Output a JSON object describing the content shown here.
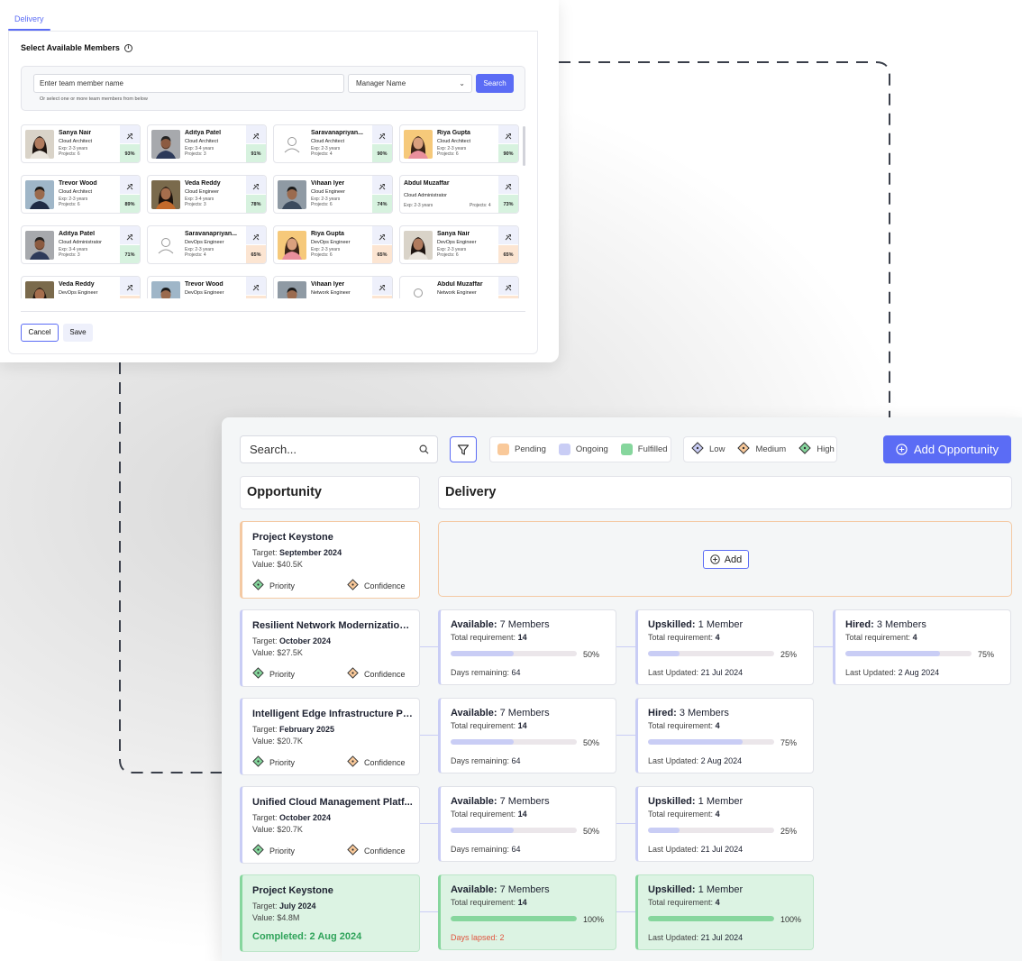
{
  "dialog": {
    "tab": "Delivery",
    "heading": "Select Available Members",
    "search": {
      "input_value": "Enter team member name",
      "manager_select": "Manager Name",
      "search_button": "Search",
      "hint": "Or select one or more team members from below"
    },
    "members": [
      {
        "name": "Sanya Nair",
        "role": "Cloud Architect",
        "exp": "Exp: 2-3 years",
        "projects": "Projects: 6",
        "pct": "93%",
        "tone": "g",
        "photo": "female-1"
      },
      {
        "name": "Aditya Patel",
        "role": "Cloud Architect",
        "exp": "Exp: 3-4 years",
        "projects": "Projects: 3",
        "pct": "91%",
        "tone": "g",
        "photo": "male-beard"
      },
      {
        "name": "Saravanapriyan...",
        "role": "Cloud Architect",
        "exp": "Exp: 2-3 years",
        "projects": "Projects: 4",
        "pct": "90%",
        "tone": "g",
        "photo": "placeholder"
      },
      {
        "name": "Riya Gupta",
        "role": "Cloud Architect",
        "exp": "Exp: 2-3 years",
        "projects": "Projects: 6",
        "pct": "90%",
        "tone": "g",
        "photo": "female-2"
      },
      {
        "name": "Trevor Wood",
        "role": "Cloud Architect",
        "exp": "Exp: 2-3 years",
        "projects": "Projects: 6",
        "pct": "89%",
        "tone": "g",
        "photo": "male-suit"
      },
      {
        "name": "Veda Reddy",
        "role": "Cloud Engineer",
        "exp": "Exp: 3-4 years",
        "projects": "Projects: 3",
        "pct": "78%",
        "tone": "g",
        "photo": "female-3"
      },
      {
        "name": "Vihaan Iyer",
        "role": "Cloud Engineer",
        "exp": "Exp: 2-3 years",
        "projects": "Projects: 6",
        "pct": "74%",
        "tone": "g",
        "photo": "male-street"
      },
      {
        "name": "Abdul Muzaffar",
        "role": "Cloud Administrator",
        "exp": "Exp: 2-3 years",
        "projects": "Projects: 4",
        "pct": "73%",
        "tone": "g",
        "photo": "none"
      },
      {
        "name": "Aditya Patel",
        "role": "Cloud Administrator",
        "exp": "Exp: 3-4 years",
        "projects": "Projects: 3",
        "pct": "71%",
        "tone": "g",
        "photo": "male-beard"
      },
      {
        "name": "Saravanapriyan...",
        "role": "DevOps Engineer",
        "exp": "Exp: 2-3 years",
        "projects": "Projects: 4",
        "pct": "65%",
        "tone": "o",
        "photo": "placeholder"
      },
      {
        "name": "Riya Gupta",
        "role": "DevOps Engineer",
        "exp": "Exp: 2-3 years",
        "projects": "Projects: 6",
        "pct": "65%",
        "tone": "o",
        "photo": "female-2"
      },
      {
        "name": "Sanya Nair",
        "role": "DevOps Engineer",
        "exp": "Exp: 2-3 years",
        "projects": "Projects: 6",
        "pct": "65%",
        "tone": "o",
        "photo": "female-1"
      },
      {
        "name": "Veda Reddy",
        "role": "DevOps Engineer",
        "exp": "",
        "projects": "",
        "pct": "",
        "tone": "o",
        "photo": "female-3"
      },
      {
        "name": "Trevor Wood",
        "role": "DevOps Engineer",
        "exp": "",
        "projects": "",
        "pct": "",
        "tone": "o",
        "photo": "male-suit"
      },
      {
        "name": "Vihaan Iyer",
        "role": "Network Engineer",
        "exp": "",
        "projects": "",
        "pct": "",
        "tone": "o",
        "photo": "male-street"
      },
      {
        "name": "Abdul Muzaffar",
        "role": "Network Engineer",
        "exp": "",
        "projects": "",
        "pct": "",
        "tone": "o",
        "photo": "placeholder"
      }
    ],
    "cancel": "Cancel",
    "save": "Save"
  },
  "board": {
    "search_placeholder": "Search...",
    "status_legend": [
      {
        "label": "Pending",
        "color": "#f9c99a"
      },
      {
        "label": "Ongoing",
        "color": "#c9cdf5"
      },
      {
        "label": "Fulfilled",
        "color": "#86d69d"
      }
    ],
    "priority_legend": [
      {
        "label": "Low",
        "color": "#c9cdf5"
      },
      {
        "label": "Medium",
        "color": "#f9c99a"
      },
      {
        "label": "High",
        "color": "#86d69d"
      }
    ],
    "add_opportunity": "Add Opportunity",
    "columns": {
      "opportunity": "Opportunity",
      "delivery": "Delivery"
    },
    "add_button": "Add",
    "labels": {
      "target": "Target:",
      "value": "Value:",
      "priority": "Priority",
      "confidence": "Confidence",
      "total_req": "Total requirement:",
      "days_remaining": "Days remaining:",
      "last_updated": "Last Updated:",
      "days_lapsed": "Days lapsed:"
    },
    "opportunities": [
      {
        "title": "Project Keystone",
        "target": "September 2024",
        "value": "$40.5K",
        "completed": ""
      },
      {
        "title": "Resilient Network Modernization...",
        "target": "October 2024",
        "value": "$27.5K",
        "completed": ""
      },
      {
        "title": "Intelligent Edge Infrastructure Pr...",
        "target": "February 2025",
        "value": "$20.7K",
        "completed": ""
      },
      {
        "title": "Unified Cloud Management Platf...",
        "target": "October 2024",
        "value": "$20.7K",
        "completed": ""
      },
      {
        "title": "Project Keystone",
        "target": "July 2024",
        "value": "$4.8M",
        "completed": "Completed: 2 Aug 2024"
      }
    ],
    "delivery_rows": [
      [],
      [
        {
          "kind": "Available:",
          "count": "7 Members",
          "req": "14",
          "pct_label": "50%",
          "pct": 0.5,
          "foot_label": "Days remaining:",
          "foot": "64"
        },
        {
          "kind": "Upskilled:",
          "count": "1 Member",
          "req": "4",
          "pct_label": "25%",
          "pct": 0.25,
          "foot_label": "Last Updated:",
          "foot": "21 Jul 2024"
        },
        {
          "kind": "Hired:",
          "count": "3 Members",
          "req": "4",
          "pct_label": "75%",
          "pct": 0.75,
          "foot_label": "Last Updated:",
          "foot": "2 Aug 2024"
        }
      ],
      [
        {
          "kind": "Available:",
          "count": "7 Members",
          "req": "14",
          "pct_label": "50%",
          "pct": 0.5,
          "foot_label": "Days remaining:",
          "foot": "64"
        },
        {
          "kind": "Hired:",
          "count": "3 Members",
          "req": "4",
          "pct_label": "75%",
          "pct": 0.75,
          "foot_label": "Last Updated:",
          "foot": "2 Aug 2024"
        }
      ],
      [
        {
          "kind": "Available:",
          "count": "7 Members",
          "req": "14",
          "pct_label": "50%",
          "pct": 0.5,
          "foot_label": "Days remaining:",
          "foot": "64"
        },
        {
          "kind": "Upskilled:",
          "count": "1 Member",
          "req": "4",
          "pct_label": "25%",
          "pct": 0.25,
          "foot_label": "Last Updated:",
          "foot": "21 Jul 2024"
        }
      ],
      [
        {
          "kind": "Available:",
          "count": "7 Members",
          "req": "14",
          "pct_label": "100%",
          "pct": 1.0,
          "foot_label": "Days lapsed:",
          "foot": "2",
          "red": true
        },
        {
          "kind": "Upskilled:",
          "count": "1 Member",
          "req": "4",
          "pct_label": "100%",
          "pct": 1.0,
          "foot_label": "Last Updated:",
          "foot": "21 Jul 2024"
        }
      ]
    ]
  }
}
